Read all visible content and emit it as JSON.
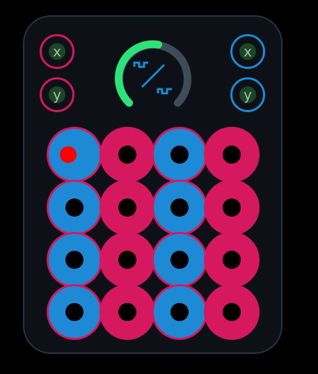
{
  "inputs": {
    "x_label": "x",
    "y_label": "y"
  },
  "outputs": {
    "x_label": "x",
    "y_label": "y"
  },
  "knob": {
    "value_fraction": 0.5,
    "icon": "waveform-shape-icon"
  },
  "colors": {
    "panel": "#0d1117",
    "panel_border": "#2b3440",
    "accent_red": "#d6185f",
    "accent_blue": "#1e8ad6",
    "knob_value": "#2ee27a",
    "knob_track": "#3e4c59",
    "active_dot": "#ff0000"
  },
  "grid": {
    "rows": [
      [
        "blue-active",
        "red",
        "blue",
        "red"
      ],
      [
        "blue",
        "red",
        "blue",
        "red"
      ],
      [
        "blue",
        "red",
        "blue",
        "red"
      ],
      [
        "blue",
        "red",
        "blue",
        "red"
      ]
    ]
  }
}
